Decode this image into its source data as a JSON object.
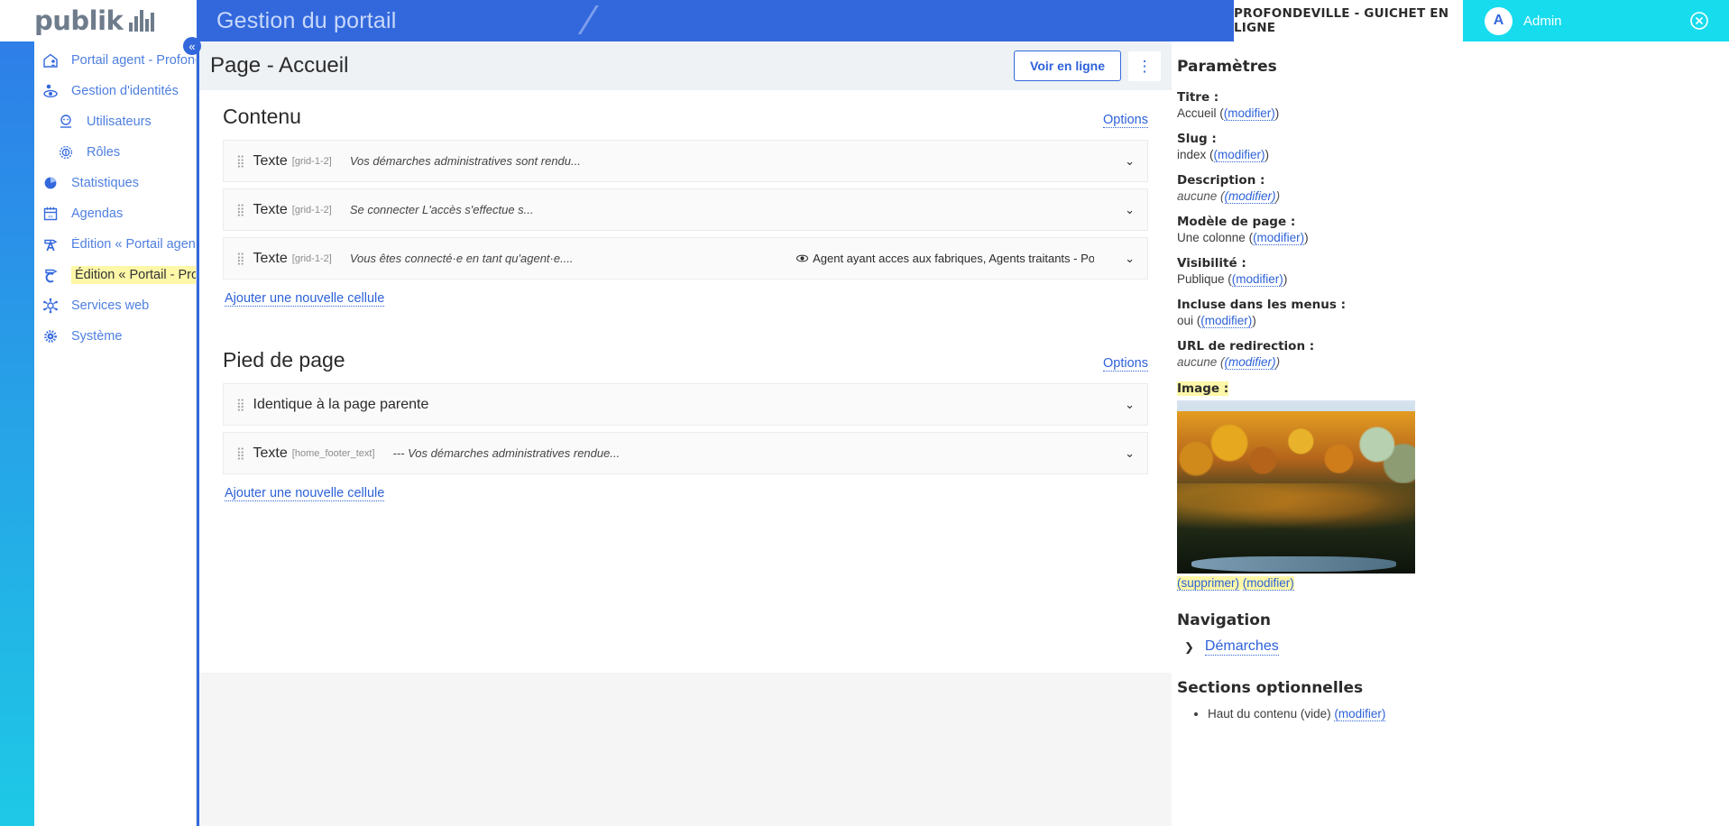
{
  "header": {
    "brand": "publik",
    "portal_title": "Gestion du portail",
    "tenant": "PROFONDEVILLE - GUICHET EN LIGNE",
    "avatar_initial": "A",
    "username": "Admin",
    "logout_icon": "logout-icon",
    "accent_blue": "#3368dd",
    "accent_cyan": "#16dcee"
  },
  "sidebar": {
    "items": [
      {
        "label": "Portail agent - Profonde...",
        "icon": "home-agent-icon",
        "active": false,
        "sub": false
      },
      {
        "label": "Gestion d'identités",
        "icon": "identity-icon",
        "active": false,
        "sub": false
      },
      {
        "label": "Utilisateurs",
        "icon": "user-icon",
        "active": false,
        "sub": true
      },
      {
        "label": "Rôles",
        "icon": "roles-icon",
        "active": false,
        "sub": true
      },
      {
        "label": "Statistiques",
        "icon": "pie-chart-icon",
        "active": false,
        "sub": false
      },
      {
        "label": "Agendas",
        "icon": "calendar-icon",
        "active": false,
        "sub": false
      },
      {
        "label": "Édition « Portail agent - ...",
        "icon": "pencil-a-icon",
        "active": false,
        "sub": false
      },
      {
        "label": "Édition « Portail - Profon..",
        "icon": "pencil-c-icon",
        "active": true,
        "sub": false
      },
      {
        "label": "Services web",
        "icon": "web-services-icon",
        "active": false,
        "sub": false
      },
      {
        "label": "Système",
        "icon": "gear-icon",
        "active": false,
        "sub": false
      }
    ],
    "collapse_icon": "«"
  },
  "main": {
    "page_title": "Page - Accueil",
    "view_online_label": "Voir en ligne",
    "kebab_label": "⋮",
    "sections": [
      {
        "title": "Contenu",
        "options_label": "Options",
        "add_cell_label": "Ajouter une nouvelle cellule",
        "cells": [
          {
            "type": "Texte",
            "slug": "[grid-1-2]",
            "preview": "Vos démarches administratives sont rendu...",
            "visibility": "",
            "chevron": "⌄"
          },
          {
            "type": "Texte",
            "slug": "[grid-1-2]",
            "preview": "Se connecter L'accès s'effectue s...",
            "visibility": "",
            "chevron": "⌄"
          },
          {
            "type": "Texte",
            "slug": "[grid-1-2]",
            "preview": "Vous êtes connecté·e en tant qu'agent·e....",
            "visibility": "Agent ayant acces aux fabriques, Agents traitants - Popul...",
            "chevron": "⌄"
          }
        ]
      },
      {
        "title": "Pied de page",
        "options_label": "Options",
        "add_cell_label": "Ajouter une nouvelle cellule",
        "cells": [
          {
            "type": "Identique à la page parente",
            "slug": "",
            "preview": "",
            "visibility": "",
            "chevron": "⌄"
          },
          {
            "type": "Texte",
            "slug": "[home_footer_text]",
            "preview": "--- Vos démarches administratives rendue...",
            "visibility": "",
            "chevron": "⌄"
          }
        ]
      }
    ]
  },
  "settings": {
    "title": "Paramètres",
    "fields": [
      {
        "label": "Titre :",
        "value": "Accueil",
        "link": "(modifier)",
        "italic": false,
        "highlight": false
      },
      {
        "label": "Slug :",
        "value": "index",
        "link": "(modifier)",
        "italic": false,
        "highlight": false
      },
      {
        "label": "Description :",
        "value": "aucune",
        "link": "(modifier)",
        "italic": true,
        "highlight": false
      },
      {
        "label": "Modèle de page :",
        "value": "Une colonne",
        "link": "(modifier)",
        "italic": false,
        "highlight": false
      },
      {
        "label": "Visibilité :",
        "value": "Publique",
        "link": "(modifier)",
        "italic": false,
        "highlight": false
      },
      {
        "label": "Incluse dans les menus :",
        "value": "oui",
        "link": "(modifier)",
        "italic": false,
        "highlight": false
      },
      {
        "label": "URL de redirection :",
        "value": "aucune",
        "link": "(modifier)",
        "italic": true,
        "highlight": false
      }
    ],
    "image": {
      "label": "Image :",
      "alt": "Photo d'automne - falaise et reflet sur la rivière",
      "delete_label": "(supprimer)",
      "edit_label": "(modifier)"
    },
    "navigation": {
      "title": "Navigation",
      "items": [
        {
          "label": "Démarches",
          "caret": "❯"
        }
      ]
    },
    "optional_sections": {
      "title": "Sections optionnelles",
      "items": [
        {
          "text": "Haut du contenu (vide)",
          "link": "(modifier)"
        }
      ]
    }
  }
}
